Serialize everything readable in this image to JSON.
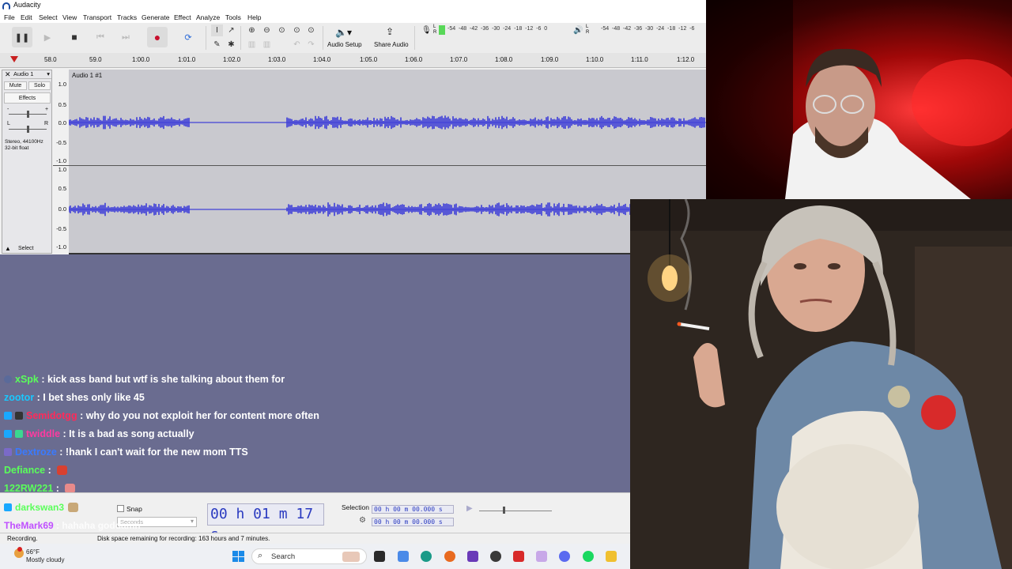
{
  "window": {
    "title": "Audacity"
  },
  "menu": [
    "File",
    "Edit",
    "Select",
    "View",
    "Transport",
    "Tracks",
    "Generate",
    "Effect",
    "Analyze",
    "Tools",
    "Help"
  ],
  "toolbar": {
    "audio_setup_label": "Audio Setup",
    "share_audio_label": "Share Audio",
    "record_meter_labels": [
      "-54",
      "-48",
      "-42",
      "-36",
      "-30",
      "-24",
      "-18",
      "-12",
      "-6",
      "0"
    ],
    "playback_meter_labels": [
      "-54",
      "-48",
      "-42",
      "-36",
      "-30",
      "-24",
      "-18",
      "-12",
      "-6"
    ]
  },
  "timeline": {
    "ticks": [
      "58.0",
      "59.0",
      "1:00.0",
      "1:01.0",
      "1:02.0",
      "1:03.0",
      "1:04.0",
      "1:05.0",
      "1:06.0",
      "1:07.0",
      "1:08.0",
      "1:09.0",
      "1:10.0",
      "1:11.0",
      "1:12.0"
    ]
  },
  "track": {
    "name": "Audio 1",
    "clip_name": "Audio 1 #1",
    "mute_label": "Mute",
    "solo_label": "Solo",
    "effects_label": "Effects",
    "format_line1": "Stereo, 44100Hz",
    "format_line2": "32-bit float",
    "select_label": "Select",
    "ruler": [
      "1.0",
      "0.5",
      "0.0",
      "-0.5",
      "-1.0",
      "1.0",
      "0.5",
      "0.0",
      "-0.5",
      "-1.0"
    ],
    "waveform_color": "#3c3cd8"
  },
  "chat": [
    {
      "user": "xSpk",
      "user_color": "#5aff5a",
      "message": ": kick ass band but wtf is she talking about them for"
    },
    {
      "user": "zootor",
      "user_color": "#19c8ff",
      "message": ": I bet shes only like 45"
    },
    {
      "user": "Semidotgg",
      "user_color": "#ff2a5a",
      "message": ": why do you not exploit her for content more often"
    },
    {
      "user": "twiddle",
      "user_color": "#ff3aa0",
      "message": ": It is a bad as song actually"
    },
    {
      "user": "Dextroze",
      "user_color": "#3a7aff",
      "message": ": !hank I can't wait for the new mom TTS"
    },
    {
      "user": "Defiance",
      "user_color": "#5aff5a",
      "message": ":"
    },
    {
      "user": "122RW221",
      "user_color": "#5aff5a",
      "message": ":"
    }
  ],
  "chat_overlap": [
    {
      "user": "darkswan3",
      "user_color": "#5aff5a"
    },
    {
      "user": "TheMark69",
      "user_color": "#c050ff",
      "message": ": hahaha goddamn"
    }
  ],
  "selection_toolbar": {
    "snap_label": "Snap",
    "seconds_label": "Seconds",
    "audio_position": "00 h 01 m 17 s",
    "selection_label": "Selection",
    "selection_start": "00 h 00 m 00.000 s",
    "selection_end": "00 h 00 m 00.000 s"
  },
  "status": {
    "state": "Recording.",
    "disk": "Disk space remaining for recording: 163 hours and 7 minutes."
  },
  "taskbar": {
    "temperature": "66°F",
    "weather": "Mostly cloudy",
    "search_placeholder": "Search"
  }
}
